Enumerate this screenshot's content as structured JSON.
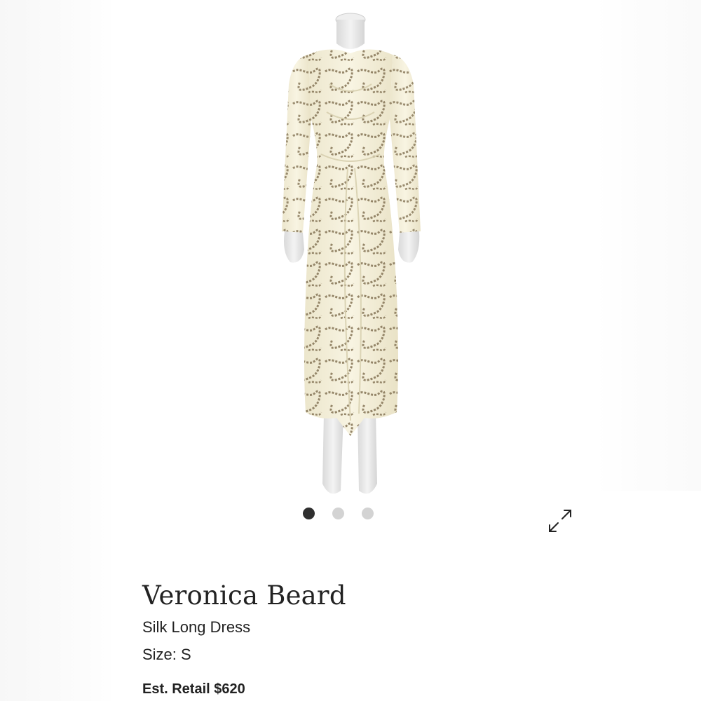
{
  "product": {
    "brand": "Veronica Beard",
    "name": "Silk Long Dress",
    "size_label": "Size:",
    "size_value": "S",
    "retail_label": "Est. Retail",
    "retail_price": "$620"
  },
  "gallery": {
    "image_count": 3,
    "active_index": 0,
    "expand_icon": "expand-arrows-icon"
  },
  "colors": {
    "dress": "#f4efdc",
    "chain_print": "#8a7a5c",
    "mannequin": "#e6e6e6",
    "dot_active": "#2f2f2f",
    "dot_inactive": "#d3d3d3",
    "text": "#222222"
  }
}
